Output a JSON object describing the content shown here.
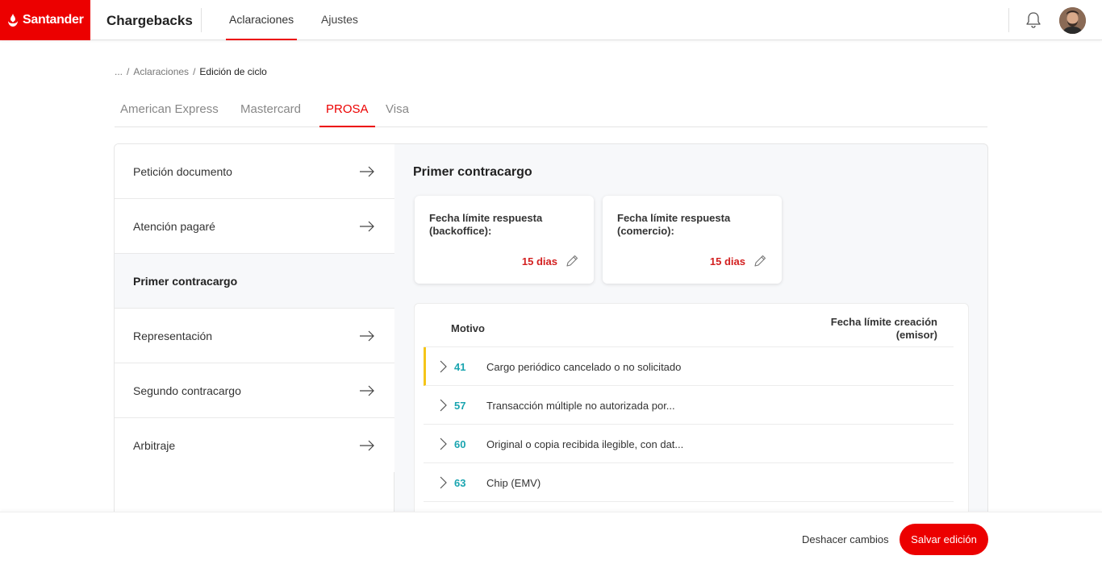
{
  "header": {
    "brand": "Santander",
    "app_title": "Chargebacks",
    "nav": [
      {
        "label": "Aclaraciones",
        "active": true
      },
      {
        "label": "Ajustes",
        "active": false
      }
    ],
    "icons": {
      "notifications": "bell-icon",
      "user": "avatar"
    }
  },
  "breadcrumb": {
    "ellipsis": "...",
    "separator": "/",
    "parent": "Aclaraciones",
    "current": "Edición de ciclo"
  },
  "card_tabs": [
    {
      "label": "American Express",
      "active": false
    },
    {
      "label": "Mastercard",
      "active": false
    },
    {
      "label": "PROSA",
      "active": true
    },
    {
      "label": "Visa",
      "active": false
    }
  ],
  "sidebar": {
    "items": [
      {
        "label": "Petición documento",
        "active": false
      },
      {
        "label": "Atención pagaré",
        "active": false
      },
      {
        "label": "Primer contracargo",
        "active": true
      },
      {
        "label": "Representación",
        "active": false
      },
      {
        "label": "Segundo contracargo",
        "active": false
      },
      {
        "label": "Arbitraje",
        "active": false
      }
    ]
  },
  "main": {
    "section_title": "Primer contracargo",
    "deadlines": [
      {
        "label": "Fecha límite respuesta (backoffice):",
        "value": "15 dias"
      },
      {
        "label": "Fecha límite respuesta (comercio):",
        "value": "15 dias"
      }
    ],
    "reasons_table": {
      "col_reason": "Motivo",
      "col_deadline_line1": "Fecha límite creación",
      "col_deadline_line2": "(emisor)",
      "rows": [
        {
          "code": "41",
          "text": "Cargo periódico cancelado o no solicitado",
          "selected": true
        },
        {
          "code": "57",
          "text": "Transacción múltiple no autorizada por...",
          "selected": false
        },
        {
          "code": "60",
          "text": "Original o copia recibida ilegible, con dat...",
          "selected": false
        },
        {
          "code": "63",
          "text": "Chip (EMV)",
          "selected": false
        }
      ]
    }
  },
  "footer": {
    "undo_label": "Deshacer cambios",
    "save_label": "Salvar edición"
  },
  "colors": {
    "brand_red": "#ec0000",
    "value_red": "#d32020",
    "code_teal": "#1aa5b0",
    "selected_marker": "#f5c518"
  }
}
